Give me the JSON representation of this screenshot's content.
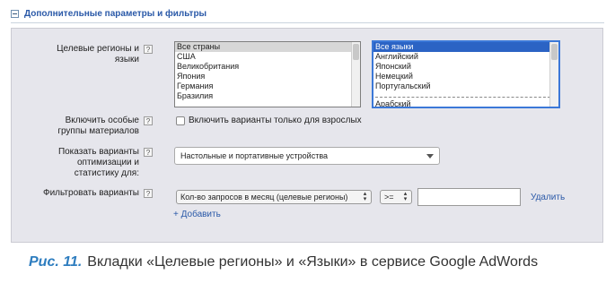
{
  "section": {
    "title": "Дополнительные параметры и фильтры"
  },
  "targeting": {
    "label": "Целевые регионы и языки",
    "help": "?",
    "regions": [
      "Все страны",
      "США",
      "Великобритания",
      "Япония",
      "Германия",
      "Бразилия"
    ],
    "regions_selected": "Все страны",
    "languages": [
      "Все языки",
      "Английский",
      "Японский",
      "Немецкий",
      "Португальский"
    ],
    "languages_after_divider": "Арабский",
    "languages_selected": "Все языки"
  },
  "special_groups": {
    "label": "Включить особые группы материалов",
    "help": "?",
    "checkbox_label": "Включить варианты только для взрослых",
    "checked": false
  },
  "stats": {
    "label": "Показать варианты оптимизации и статистику для:",
    "help": "?",
    "selected": "Настольные и портативные устройства"
  },
  "filter": {
    "label": "Фильтровать варианты",
    "help": "?",
    "metric": "Кол-во запросов в месяц (целевые регионы)",
    "operator": ">=",
    "value": "",
    "delete_label": "Удалить",
    "add_label": "+ Добавить"
  },
  "caption": {
    "figure": "Рис. 11.",
    "text": "Вкладки «Целевые регионы» и «Языки» в сервисе Google AdWords"
  },
  "colors": {
    "accent": "#2a59a8",
    "selection": "#2b63c4",
    "panel": "#e6e6ec",
    "figure_label": "#2e7dbf"
  }
}
